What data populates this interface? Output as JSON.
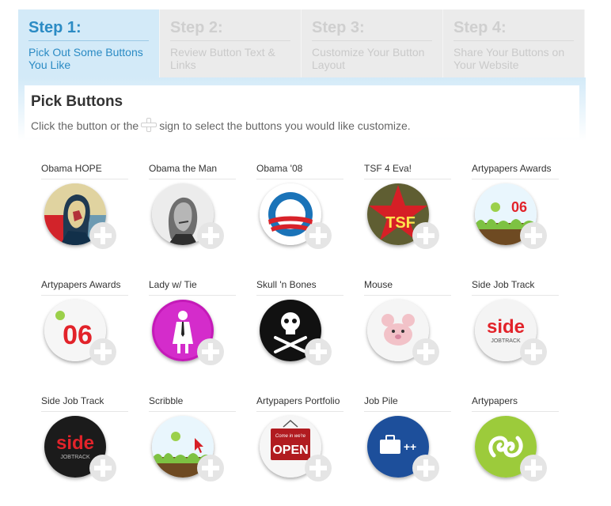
{
  "steps": [
    {
      "num": "Step 1:",
      "desc": "Pick Out Some Buttons You Like",
      "active": true
    },
    {
      "num": "Step 2:",
      "desc": "Review Button Text & Links",
      "active": false
    },
    {
      "num": "Step 3:",
      "desc": "Customize Your Button Layout",
      "active": false
    },
    {
      "num": "Step 4:",
      "desc": "Share Your Buttons on Your Website",
      "active": false
    }
  ],
  "section": {
    "title": "Pick Buttons",
    "instruction_before": "Click the button or the",
    "instruction_after": "sign to select the buttons you would like customize."
  },
  "buttons": [
    {
      "title": "Obama HOPE",
      "icon": "obama-hope-icon"
    },
    {
      "title": "Obama the Man",
      "icon": "obama-man-icon"
    },
    {
      "title": "Obama '08",
      "icon": "obama-08-logo-icon"
    },
    {
      "title": "TSF 4 Eva!",
      "icon": "tsf-star-icon",
      "badge_text": "TSF"
    },
    {
      "title": "Artypapers Awards",
      "icon": "artypapers-awards-icon",
      "badge_text": "06"
    },
    {
      "title": "Artypapers Awards",
      "icon": "artypapers-06-icon",
      "badge_text": "06"
    },
    {
      "title": "Lady w/ Tie",
      "icon": "lady-with-tie-icon"
    },
    {
      "title": "Skull 'n Bones",
      "icon": "skull-and-bones-icon"
    },
    {
      "title": "Mouse",
      "icon": "mouse-icon"
    },
    {
      "title": "Side Job Track",
      "icon": "side-jobtrack-light-icon",
      "badge_text": "side",
      "badge_sub": "JOBTRACK"
    },
    {
      "title": "Side Job Track",
      "icon": "side-jobtrack-dark-icon",
      "badge_text": "side",
      "badge_sub": "JOBTRACK"
    },
    {
      "title": "Scribble",
      "icon": "scribble-icon"
    },
    {
      "title": "Artypapers Portfolio",
      "icon": "open-sign-icon",
      "badge_text": "OPEN",
      "badge_top": "Come in we're"
    },
    {
      "title": "Job Pile",
      "icon": "briefcase-icon",
      "badge_text": "++"
    },
    {
      "title": "Artypapers",
      "icon": "artypapers-logo-icon"
    }
  ],
  "colors": {
    "step_active_bg": "#d3eaf8",
    "step_active_text": "#2b8bc4",
    "step_inactive_bg": "#ebebeb",
    "step_inactive_text": "#cacaca"
  }
}
